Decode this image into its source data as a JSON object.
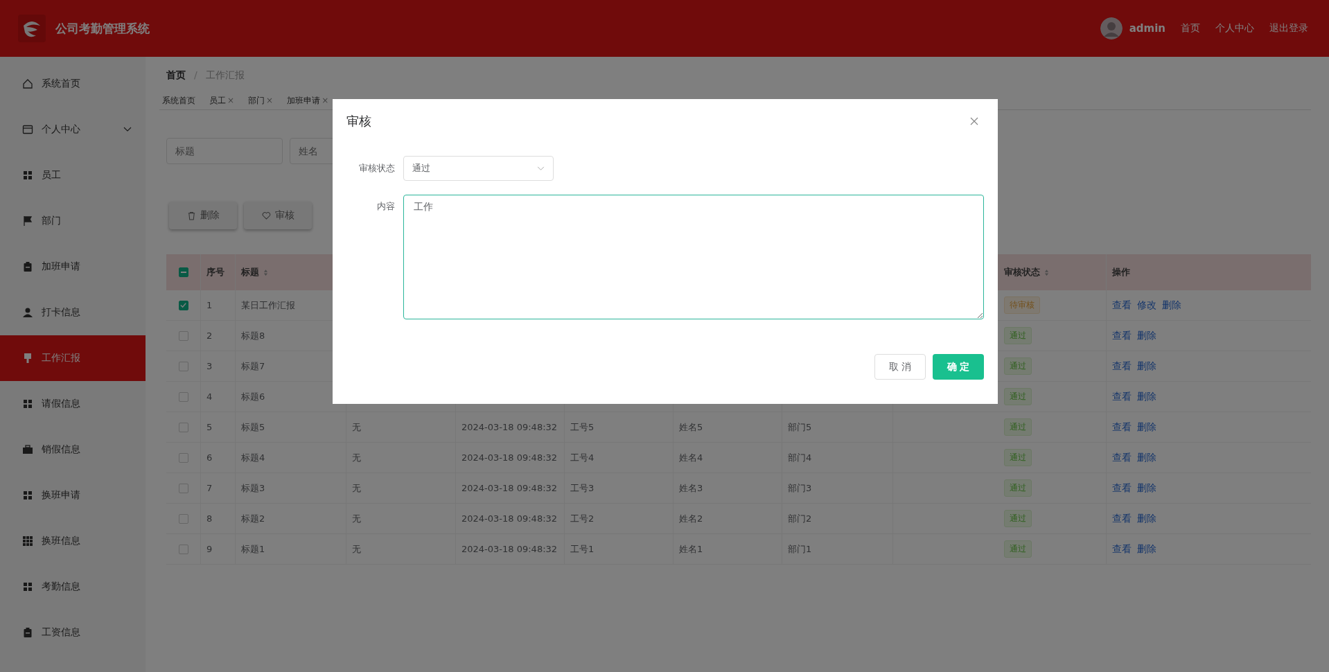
{
  "header": {
    "title": "公司考勤管理系统",
    "user": "admin",
    "links": [
      "首页",
      "个人中心",
      "退出登录"
    ]
  },
  "sidebar": {
    "items": [
      {
        "label": "系统首页",
        "selected": false
      },
      {
        "label": "个人中心",
        "selected": false,
        "expandable": true
      },
      {
        "label": "员工",
        "selected": false
      },
      {
        "label": "部门",
        "selected": false
      },
      {
        "label": "加班申请",
        "selected": false
      },
      {
        "label": "打卡信息",
        "selected": false
      },
      {
        "label": "工作汇报",
        "selected": true
      },
      {
        "label": "请假信息",
        "selected": false
      },
      {
        "label": "销假信息",
        "selected": false
      },
      {
        "label": "换班申请",
        "selected": false
      },
      {
        "label": "换班信息",
        "selected": false
      },
      {
        "label": "考勤信息",
        "selected": false
      },
      {
        "label": "工资信息",
        "selected": false
      }
    ]
  },
  "breadcrumb": {
    "items": [
      "首页",
      "工作汇报"
    ],
    "separator": "/"
  },
  "tabs": [
    {
      "label": "系统首页",
      "selected": false
    },
    {
      "label": "员工",
      "close": "×",
      "selected": false
    },
    {
      "label": "部门",
      "close": "×",
      "selected": false
    },
    {
      "label": "加班申请",
      "close": "×",
      "selected": false
    }
  ],
  "search": [
    {
      "placeholder": "标题"
    },
    {
      "placeholder": "姓名"
    }
  ],
  "actions": [
    "删除",
    "审核"
  ],
  "table": {
    "select_all_indeterminate": true,
    "columns": [
      {
        "label": "序号",
        "sortable": false
      },
      {
        "label": "标题",
        "sortable": true
      },
      {
        "label": "审核状态",
        "sortable": true
      },
      {
        "label": "操作",
        "sortable": false
      }
    ],
    "rows": [
      {
        "checked": true,
        "index": "1",
        "title": "某日工作汇报",
        "status": "待审核",
        "kind": "pending",
        "actions": [
          "查看",
          "修改",
          "删除"
        ]
      },
      {
        "checked": false,
        "index": "2",
        "title": "标题8",
        "status": "通过",
        "kind": "passed",
        "actions": [
          "查看",
          "删除"
        ]
      },
      {
        "checked": false,
        "index": "3",
        "title": "标题7",
        "status": "通过",
        "kind": "passed",
        "actions": [
          "查看",
          "删除"
        ]
      },
      {
        "checked": false,
        "index": "4",
        "title": "标题6",
        "status": "通过",
        "kind": "passed",
        "actions": [
          "查看",
          "删除"
        ]
      },
      {
        "checked": false,
        "index": "5",
        "title": "标题5",
        "content": "无",
        "time": "2024-03-18 09:48:32",
        "emp_no": "工号5",
        "name": "姓名5",
        "dept": "部门5",
        "status": "通过",
        "kind": "passed",
        "actions": [
          "查看",
          "删除"
        ]
      },
      {
        "checked": false,
        "index": "6",
        "title": "标题4",
        "content": "无",
        "time": "2024-03-18 09:48:32",
        "emp_no": "工号4",
        "name": "姓名4",
        "dept": "部门4",
        "status": "通过",
        "kind": "passed",
        "actions": [
          "查看",
          "删除"
        ]
      },
      {
        "checked": false,
        "index": "7",
        "title": "标题3",
        "content": "无",
        "time": "2024-03-18 09:48:32",
        "emp_no": "工号3",
        "name": "姓名3",
        "dept": "部门3",
        "status": "通过",
        "kind": "passed",
        "actions": [
          "查看",
          "删除"
        ]
      },
      {
        "checked": false,
        "index": "8",
        "title": "标题2",
        "content": "无",
        "time": "2024-03-18 09:48:32",
        "emp_no": "工号2",
        "name": "姓名2",
        "dept": "部门2",
        "status": "通过",
        "kind": "passed",
        "actions": [
          "查看",
          "删除"
        ]
      },
      {
        "checked": false,
        "index": "9",
        "title": "标题1",
        "content": "无",
        "time": "2024-03-18 09:48:32",
        "emp_no": "工号1",
        "name": "姓名1",
        "dept": "部门1",
        "status": "通过",
        "kind": "passed",
        "actions": [
          "查看",
          "删除"
        ]
      }
    ]
  },
  "dialog": {
    "title": "审核",
    "fields": [
      {
        "label": "审核状态",
        "kind": "select",
        "value": "通过"
      },
      {
        "label": "内容",
        "kind": "textarea",
        "value": "工作"
      }
    ],
    "buttons": [
      {
        "label": "取 消",
        "kind": "default"
      },
      {
        "label": "确 定",
        "kind": "primary"
      }
    ]
  }
}
